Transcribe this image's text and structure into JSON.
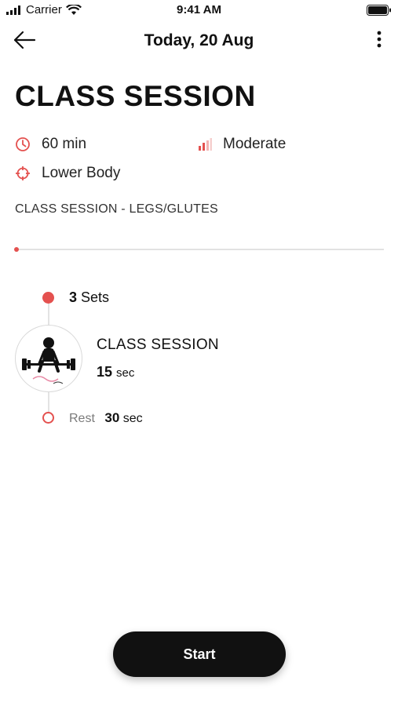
{
  "status_bar": {
    "carrier": "Carrier",
    "time": "9:41 AM"
  },
  "header": {
    "title": "Today, 20 Aug"
  },
  "workout": {
    "title": "CLASS SESSION",
    "duration": "60 min",
    "intensity": "Moderate",
    "focus": "Lower Body",
    "description": "CLASS SESSION - LEGS/GLUTES",
    "progress_fraction": 0
  },
  "timeline": {
    "sets_count": "3",
    "sets_label": "Sets",
    "exercise": {
      "name": "CLASS SESSION",
      "duration_value": "15",
      "duration_unit": "sec"
    },
    "rest": {
      "label": "Rest",
      "value": "30",
      "unit": "sec"
    }
  },
  "actions": {
    "start_label": "Start"
  },
  "colors": {
    "accent": "#e4514f",
    "button_bg": "#111111",
    "track": "#e2e2e2"
  },
  "icons": [
    "signal-icon",
    "wifi-icon",
    "battery-icon",
    "back-arrow-icon",
    "more-vertical-icon",
    "clock-icon",
    "intensity-bars-icon",
    "target-icon",
    "exercise-thumbnail"
  ]
}
